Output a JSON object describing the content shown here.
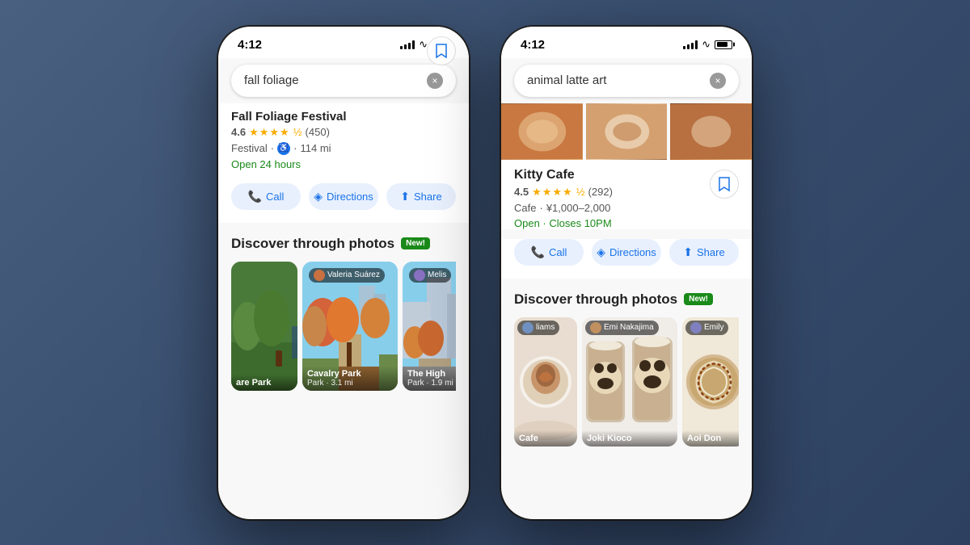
{
  "background": {
    "gradient": "steel-blue"
  },
  "phones": [
    {
      "id": "left-phone",
      "status": {
        "time": "4:12",
        "signal": "full",
        "wifi": true,
        "battery": 80
      },
      "search": {
        "query": "fall foliage",
        "clear_label": "×"
      },
      "top_partial": {
        "name": "Fall Foliage Festival",
        "partial": true
      },
      "place": {
        "name": "Fall Foliage Festival",
        "rating": "4.6",
        "stars": "★★★★½",
        "review_count": "(450)",
        "category": "Festival",
        "accessible": true,
        "distance": "114 mi",
        "status": "Open 24 hours",
        "status_color": "#1a8a1a"
      },
      "actions": [
        {
          "id": "call",
          "label": "Call",
          "icon": "📞"
        },
        {
          "id": "directions",
          "label": "Directions",
          "icon": "◈"
        },
        {
          "id": "share",
          "label": "Share",
          "icon": "↑"
        }
      ],
      "discover": {
        "title": "Discover through photos",
        "badge": "New!"
      },
      "photos": [
        {
          "id": "photo-1",
          "user": null,
          "caption": "are Park",
          "sub": "",
          "type": "park-green"
        },
        {
          "id": "photo-2",
          "user": "Valeria Suárez",
          "caption": "Cavalry Park",
          "sub": "Park · 3.1 mi",
          "type": "fall-orange"
        },
        {
          "id": "photo-3",
          "user": "Melis",
          "caption": "The High",
          "sub": "Park · 1.9 mi",
          "type": "fall-blue-sky"
        }
      ]
    },
    {
      "id": "right-phone",
      "status": {
        "time": "4:12",
        "signal": "full",
        "wifi": true,
        "battery": 80
      },
      "search": {
        "query": "animal latte art",
        "clear_label": "×"
      },
      "place": {
        "name": "Kitty Cafe",
        "rating": "4.5",
        "stars": "★★★★½",
        "review_count": "(292)",
        "category": "Cafe",
        "price": "¥1,000–2,000",
        "status": "Open · Closes 10PM",
        "status_color": "#1a8a1a"
      },
      "actions": [
        {
          "id": "call",
          "label": "Call",
          "icon": "📞"
        },
        {
          "id": "directions",
          "label": "Directions",
          "icon": "◈"
        },
        {
          "id": "share",
          "label": "Share",
          "icon": "↑"
        }
      ],
      "discover": {
        "title": "Discover through photos",
        "badge": "New!"
      },
      "photos": [
        {
          "id": "photo-r1",
          "user": "liams",
          "caption": "Cafe",
          "sub": "",
          "type": "latte-white"
        },
        {
          "id": "photo-r2",
          "user": "Emi Nakajima",
          "caption": "Joki Kioco",
          "sub": "",
          "type": "latte-panda"
        },
        {
          "id": "photo-r3",
          "user": "Emily",
          "caption": "Aoi Don",
          "sub": "",
          "type": "latte-swirl"
        }
      ]
    }
  ],
  "icons": {
    "call": "📞",
    "directions": "◈",
    "share": "⬆",
    "bookmark": "🔖",
    "clear": "✕"
  }
}
